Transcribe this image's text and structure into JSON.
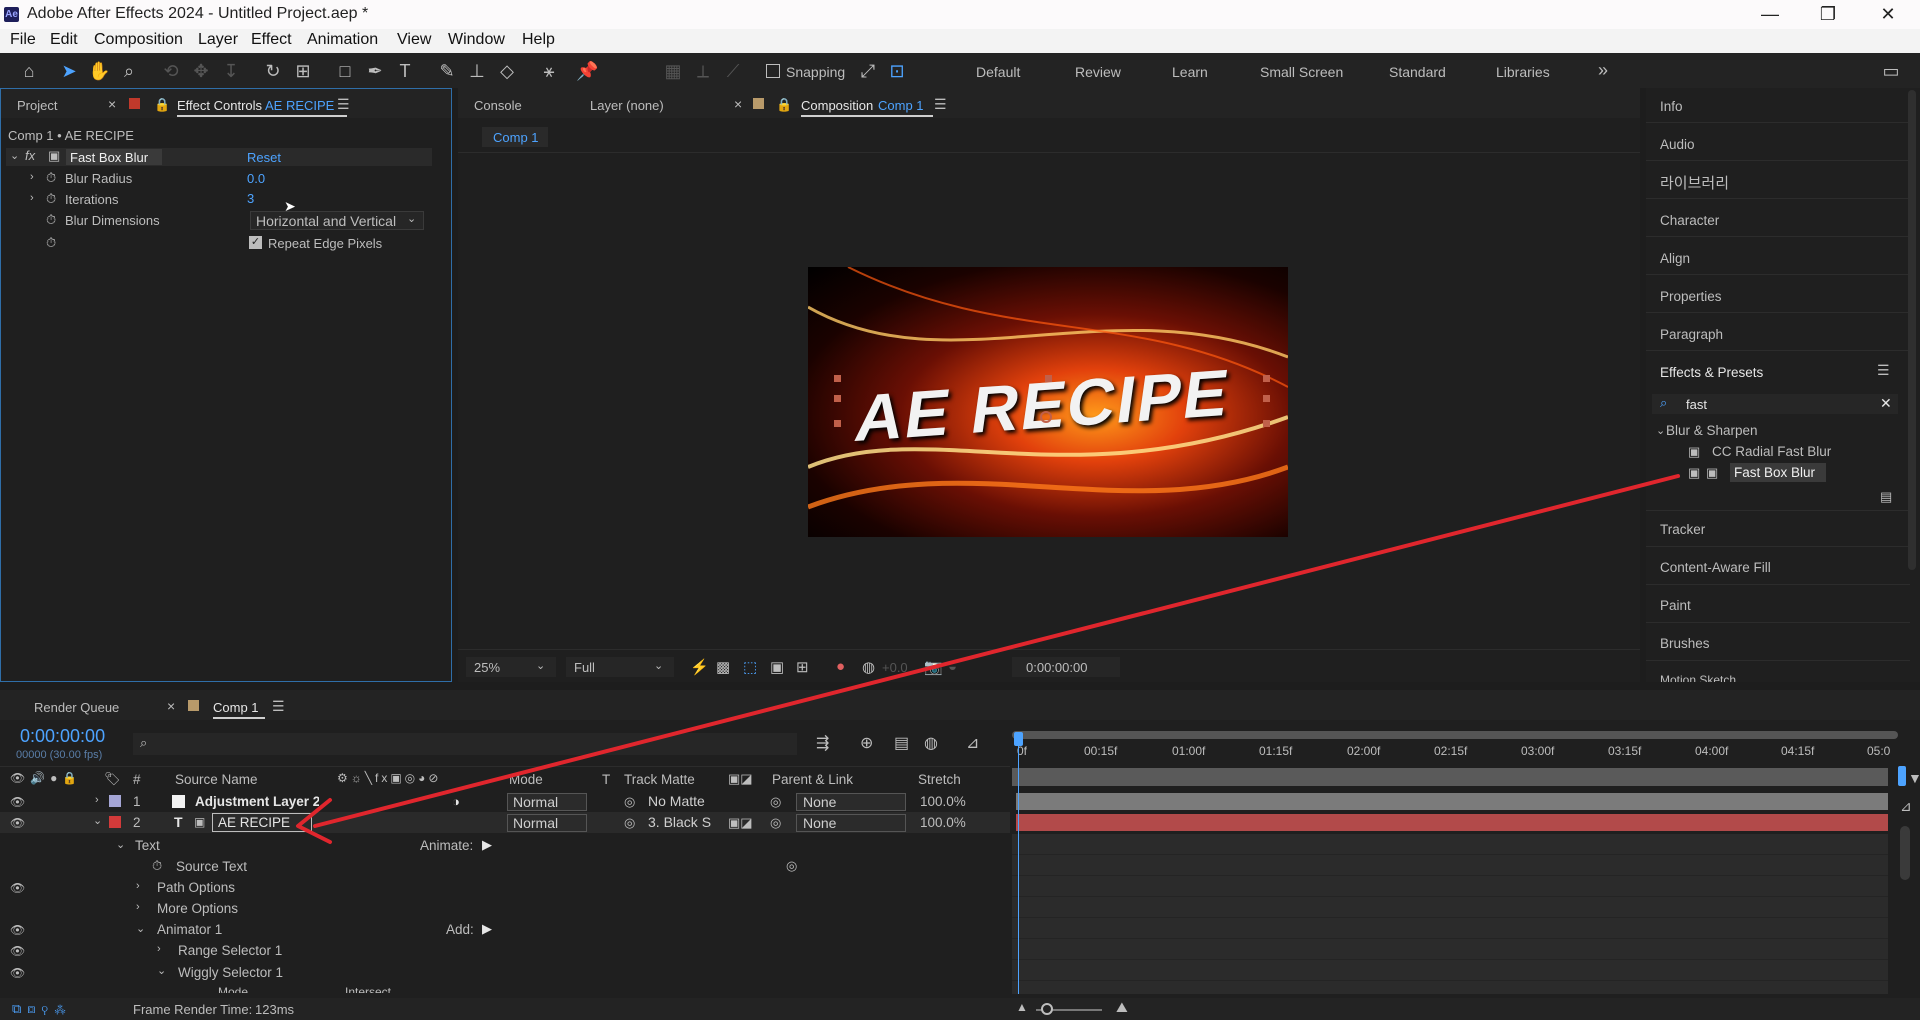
{
  "window": {
    "title": "Adobe After Effects 2024 - Untitled Project.aep *",
    "app_badge": "Ae"
  },
  "menu": [
    "File",
    "Edit",
    "Composition",
    "Layer",
    "Effect",
    "Animation",
    "View",
    "Window",
    "Help"
  ],
  "toolbar": {
    "snapping": "Snapping",
    "workspaces": [
      "Default",
      "Review",
      "Learn",
      "Small Screen",
      "Standard",
      "Libraries"
    ],
    "more": "»"
  },
  "left_panel": {
    "tab_project": "Project",
    "tab_effect": "Effect Controls",
    "tab_effect_layer": "AE RECIPE",
    "breadcrumb": "Comp 1 • AE RECIPE",
    "effect": {
      "name": "Fast Box Blur",
      "reset": "Reset",
      "props": [
        {
          "label": "Blur Radius",
          "value": "0.0"
        },
        {
          "label": "Iterations",
          "value": "3"
        },
        {
          "label": "Blur Dimensions",
          "value": "Horizontal and Vertical"
        }
      ],
      "checkbox": "Repeat Edge Pixels"
    }
  },
  "center_panel": {
    "tab_console": "Console",
    "tab_layer": "Layer (none)",
    "tab_comp": "Composition",
    "tab_comp_name": "Comp 1",
    "comp_chip": "Comp 1",
    "canvas_text": "AE RECIPE",
    "zoom": "25%",
    "resolution": "Full",
    "timecode": "0:00:00:00",
    "exposure": "+0.0"
  },
  "right_panel": {
    "items": [
      "Info",
      "Audio",
      "라이브러리",
      "Character",
      "Align",
      "Properties",
      "Paragraph"
    ],
    "effects_title": "Effects & Presets",
    "search": "fast",
    "category": "Blur & Sharpen",
    "results": [
      "CC Radial Fast Blur",
      "Fast Box Blur"
    ],
    "more_items": [
      "Tracker",
      "Content-Aware Fill",
      "Paint",
      "Brushes",
      "Motion Sketch"
    ]
  },
  "timeline": {
    "tab_render": "Render Queue",
    "tab_comp": "Comp 1",
    "timecode": "0:00:00:00",
    "fps": "00000 (30.00 fps)",
    "headers": {
      "num": "#",
      "source": "Source Name",
      "mode": "Mode",
      "t": "T",
      "matte": "Track Matte",
      "parent": "Parent & Link",
      "stretch": "Stretch"
    },
    "layers": [
      {
        "num": "1",
        "name": "Adjustment Layer 2",
        "mode": "Normal",
        "matte": "No Matte",
        "parent": "None",
        "stretch": "100.0%"
      },
      {
        "num": "2",
        "name": "AE RECIPE",
        "mode": "Normal",
        "matte": "3. Black S",
        "parent": "None",
        "stretch": "100.0%"
      }
    ],
    "props": {
      "text": "Text",
      "animate": "Animate:",
      "source_text": "Source Text",
      "path_options": "Path Options",
      "more_options": "More Options",
      "animator": "Animator 1",
      "add": "Add:",
      "range": "Range Selector 1",
      "wiggly": "Wiggly Selector 1",
      "mode": "Mode",
      "mode_value": "Intersect"
    },
    "ruler": [
      "0f",
      "00:15f",
      "01:00f",
      "01:15f",
      "02:00f",
      "02:15f",
      "03:00f",
      "03:15f",
      "04:00f",
      "04:15f",
      "05:0"
    ],
    "status_label": "Frame Render Time:",
    "status_value": "123ms"
  },
  "colors": {
    "accent": "#4da3ff",
    "arrow": "#e0262d",
    "layer_bar_adj": "#7b7b7b",
    "layer_bar_text": "#b24a4a"
  }
}
